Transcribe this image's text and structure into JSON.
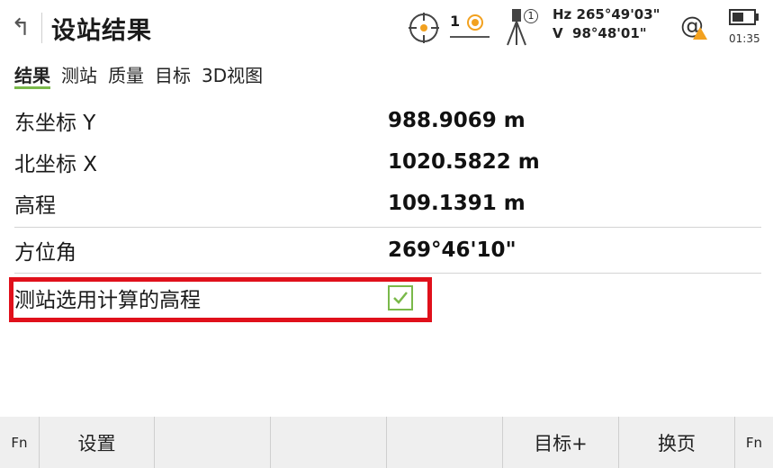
{
  "header": {
    "back_icon": "back-arrow-icon",
    "title": "设站结果",
    "prism_number": "1",
    "tripod_number": "1",
    "hz": "Hz 265°49'03\"",
    "v": "V  98°48'01\"",
    "time": "01:35",
    "warning_color": "#f2a11f"
  },
  "tabs": [
    {
      "label": "结果",
      "active": true
    },
    {
      "label": "测站",
      "active": false
    },
    {
      "label": "质量",
      "active": false
    },
    {
      "label": "目标",
      "active": false
    },
    {
      "label": "3D视图",
      "active": false
    }
  ],
  "results": {
    "east_label": "东坐标 Y",
    "east_value": "988.9069 m",
    "north_label": "北坐标 X",
    "north_value": "1020.5822 m",
    "height_label": "高程",
    "height_value": "109.1391 m",
    "azimuth_label": "方位角",
    "azimuth_value": "269°46'10\"",
    "use_computed_height_label": "测站选用计算的高程",
    "use_computed_height_checked": true
  },
  "bottom_bar": {
    "fn_left": "Fn",
    "settings": "设置",
    "target_plus": "目标+",
    "page_switch": "换页",
    "fn_right": "Fn"
  },
  "colors": {
    "accent_green": "#7ab94a",
    "highlight_red": "#e0101b"
  }
}
